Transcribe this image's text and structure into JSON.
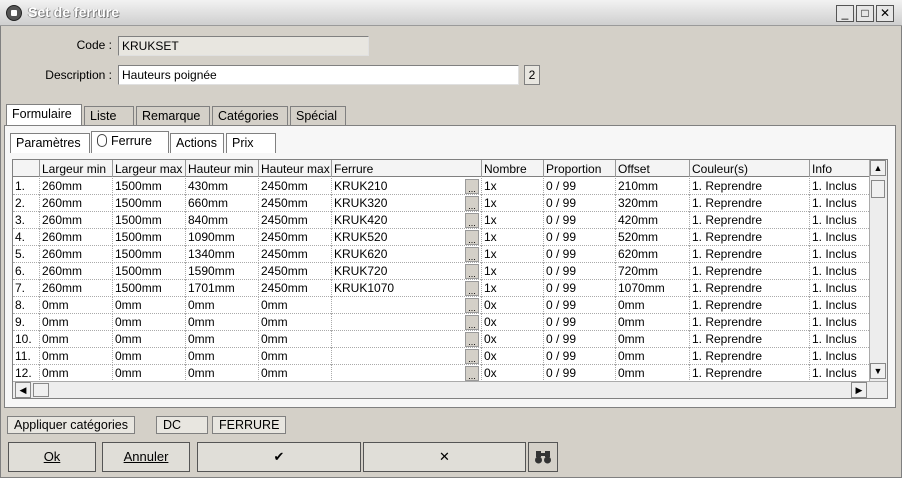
{
  "window": {
    "title": "Set de ferrure",
    "minimize": "_",
    "maximize": "□",
    "close": "✕"
  },
  "form": {
    "code_label": "Code :",
    "code_value": "KRUKSET",
    "description_label": "Description :",
    "description_value": "Hauteurs poignée",
    "description_count": "2"
  },
  "tabs": [
    "Formulaire",
    "Liste",
    "Remarque",
    "Catégories",
    "Spécial"
  ],
  "subtabs": [
    "Paramètres",
    "Ferrure",
    "Actions",
    "Prix"
  ],
  "grid": {
    "columns": [
      "Largeur min",
      "Largeur max",
      "Hauteur min",
      "Hauteur max",
      "Ferrure",
      "Nombre",
      "Proportion",
      "Offset",
      "Couleur(s)",
      "Info"
    ],
    "ellipsis": "...",
    "rows": [
      [
        "1.",
        "260mm",
        "1500mm",
        "430mm",
        "2450mm",
        "KRUK210",
        "1x",
        "0 / 99",
        "210mm",
        "1. Reprendre",
        "1. Inclus"
      ],
      [
        "2.",
        "260mm",
        "1500mm",
        "660mm",
        "2450mm",
        "KRUK320",
        "1x",
        "0 / 99",
        "320mm",
        "1. Reprendre",
        "1. Inclus"
      ],
      [
        "3.",
        "260mm",
        "1500mm",
        "840mm",
        "2450mm",
        "KRUK420",
        "1x",
        "0 / 99",
        "420mm",
        "1. Reprendre",
        "1. Inclus"
      ],
      [
        "4.",
        "260mm",
        "1500mm",
        "1090mm",
        "2450mm",
        "KRUK520",
        "1x",
        "0 / 99",
        "520mm",
        "1. Reprendre",
        "1. Inclus"
      ],
      [
        "5.",
        "260mm",
        "1500mm",
        "1340mm",
        "2450mm",
        "KRUK620",
        "1x",
        "0 / 99",
        "620mm",
        "1. Reprendre",
        "1. Inclus"
      ],
      [
        "6.",
        "260mm",
        "1500mm",
        "1590mm",
        "2450mm",
        "KRUK720",
        "1x",
        "0 / 99",
        "720mm",
        "1. Reprendre",
        "1. Inclus"
      ],
      [
        "7.",
        "260mm",
        "1500mm",
        "1701mm",
        "2450mm",
        "KRUK1070",
        "1x",
        "0 / 99",
        "1070mm",
        "1. Reprendre",
        "1. Inclus"
      ],
      [
        "8.",
        "0mm",
        "0mm",
        "0mm",
        "0mm",
        "",
        "0x",
        "0 / 99",
        "0mm",
        "1. Reprendre",
        "1. Inclus"
      ],
      [
        "9.",
        "0mm",
        "0mm",
        "0mm",
        "0mm",
        "",
        "0x",
        "0 / 99",
        "0mm",
        "1. Reprendre",
        "1. Inclus"
      ],
      [
        "10.",
        "0mm",
        "0mm",
        "0mm",
        "0mm",
        "",
        "0x",
        "0 / 99",
        "0mm",
        "1. Reprendre",
        "1. Inclus"
      ],
      [
        "11.",
        "0mm",
        "0mm",
        "0mm",
        "0mm",
        "",
        "0x",
        "0 / 99",
        "0mm",
        "1. Reprendre",
        "1. Inclus"
      ],
      [
        "12.",
        "0mm",
        "0mm",
        "0mm",
        "0mm",
        "",
        "0x",
        "0 / 99",
        "0mm",
        "1. Reprendre",
        "1. Inclus"
      ]
    ]
  },
  "bottom": {
    "apply_categories": "Appliquer catégories",
    "category_1": "DC",
    "category_2": "FERRURE",
    "ok": "Ok",
    "cancel": "Annuler",
    "check": "✔",
    "cross": "✕",
    "binoculars_icon": "binoculars-icon"
  }
}
